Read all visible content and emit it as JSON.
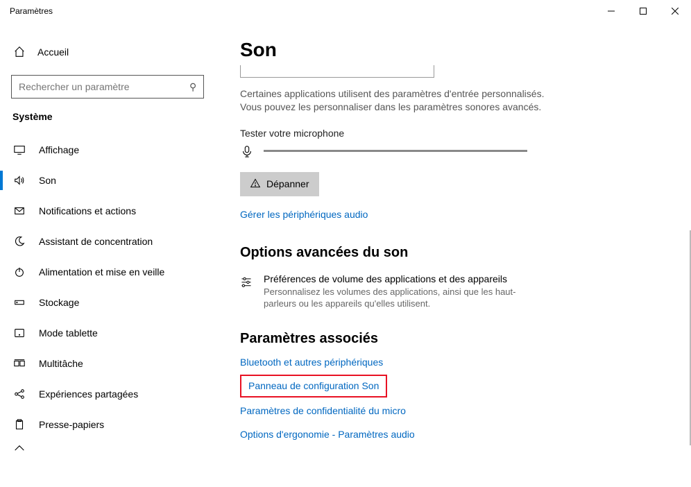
{
  "window": {
    "title": "Paramètres"
  },
  "sidebar": {
    "home": "Accueil",
    "search_placeholder": "Rechercher un paramètre",
    "category": "Système",
    "items": [
      {
        "label": "Affichage"
      },
      {
        "label": "Son"
      },
      {
        "label": "Notifications et actions"
      },
      {
        "label": "Assistant de concentration"
      },
      {
        "label": "Alimentation et mise en veille"
      },
      {
        "label": "Stockage"
      },
      {
        "label": "Mode tablette"
      },
      {
        "label": "Multitâche"
      },
      {
        "label": "Expériences partagées"
      },
      {
        "label": "Presse-papiers"
      }
    ]
  },
  "main": {
    "title": "Son",
    "info": "Certaines applications utilisent des paramètres d'entrée personnalisés. Vous pouvez les personnaliser dans les paramètres sonores avancés.",
    "test_label": "Tester votre microphone",
    "troubleshoot": "Dépanner",
    "manage_link": "Gérer les périphériques audio",
    "advanced_heading": "Options avancées du son",
    "pref_title": "Préférences de volume des applications et des appareils",
    "pref_desc": "Personnalisez les volumes des applications, ainsi que les haut-parleurs ou les appareils qu'elles utilisent.",
    "related_heading": "Paramètres associés",
    "related_links": {
      "bluetooth": "Bluetooth et autres périphériques",
      "panel": "Panneau de configuration Son",
      "privacy": "Paramètres de confidentialité du micro",
      "ease": "Options d'ergonomie - Paramètres audio"
    }
  }
}
